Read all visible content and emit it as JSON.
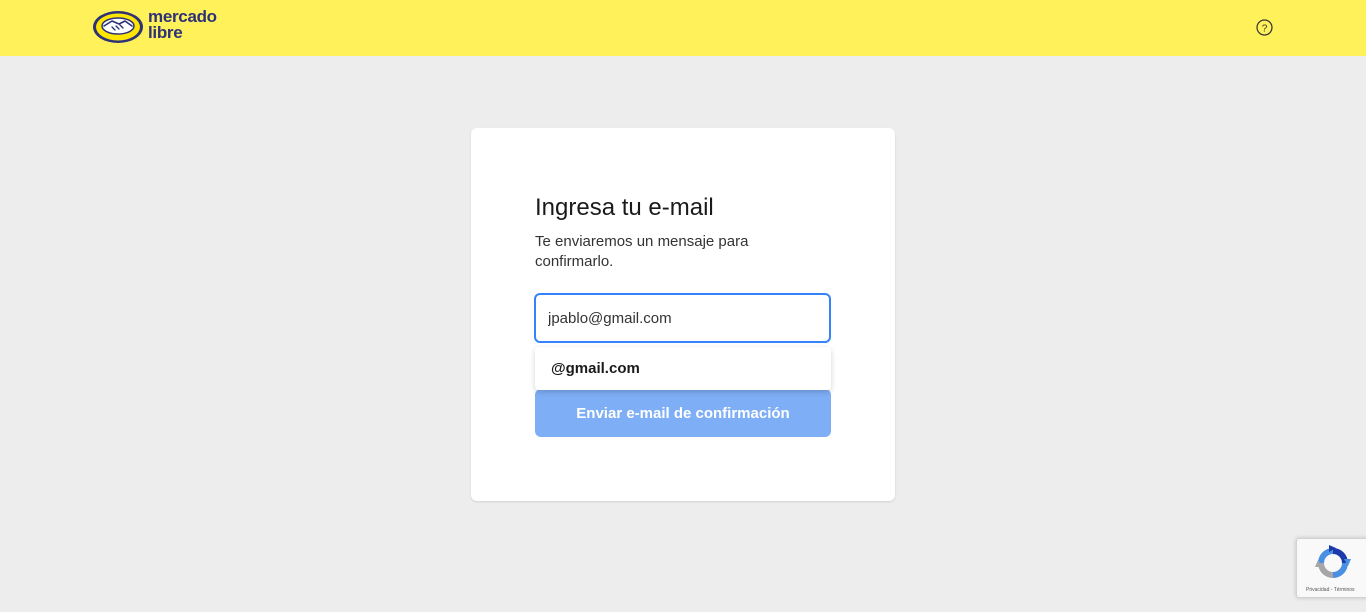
{
  "header": {
    "logo_line1": "mercado",
    "logo_line2": "libre",
    "help_label": "?"
  },
  "card": {
    "title": "Ingresa tu e-mail",
    "subtitle": "Te enviaremos un mensaje para confirmarlo.",
    "email_value": "jpablo@gmail.com",
    "suggestion": "@gmail.com",
    "submit_label": "Enviar e-mail de confirmación"
  },
  "recaptcha": {
    "links": "Privacidad - Términos"
  },
  "colors": {
    "header_bg": "#fff159",
    "page_bg": "#ededed",
    "accent": "#3483fa",
    "button_disabled": "#7eaef5",
    "brand_text": "#2d3277"
  }
}
